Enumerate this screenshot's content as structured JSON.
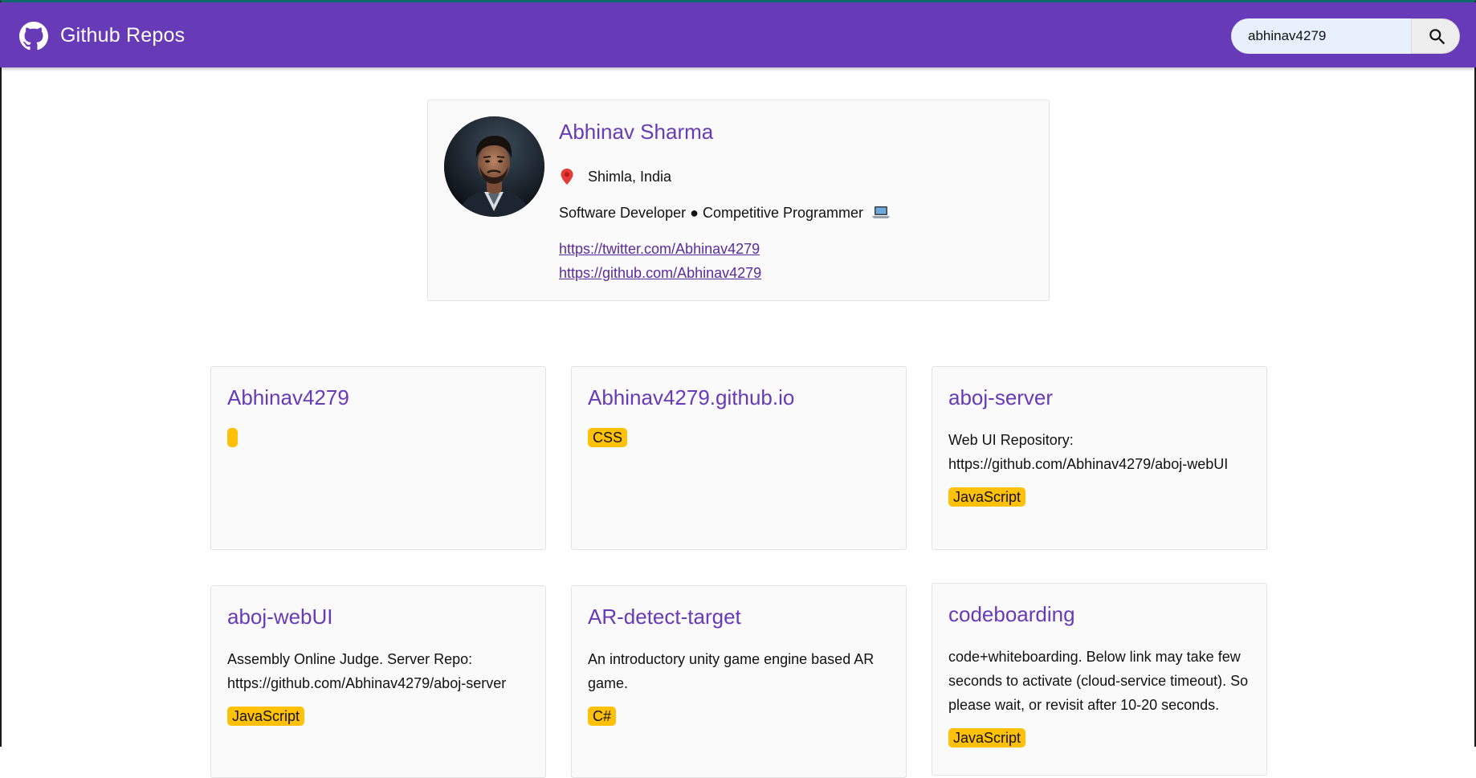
{
  "header": {
    "title": "Github Repos",
    "logo_icon": "github-icon",
    "brand_color": "#673ab7"
  },
  "search": {
    "value": "abhinav4279",
    "button_icon": "search-icon"
  },
  "profile": {
    "name": "Abhinav Sharma",
    "location_icon": "pin-icon",
    "location": "Shimla, India",
    "bio": "Software Developer ● Competitive Programmer",
    "bio_icon": "laptop-icon",
    "twitter_url": "https://twitter.com/Abhinav4279",
    "github_url": "https://github.com/Abhinav4279"
  },
  "repos": [
    {
      "name": "Abhinav4279",
      "description": "",
      "language": ""
    },
    {
      "name": "Abhinav4279.github.io",
      "description": "",
      "language": "CSS"
    },
    {
      "name": "aboj-server",
      "description": "Web UI Repository: https://github.com/Abhinav4279/aboj-webUI",
      "language": "JavaScript"
    },
    {
      "name": "aboj-webUI",
      "description": "Assembly Online Judge. Server Repo: https://github.com/Abhinav4279/aboj-server",
      "language": "JavaScript"
    },
    {
      "name": "AR-detect-target",
      "description": "An introductory unity game engine based AR game.",
      "language": "C#"
    },
    {
      "name": "codeboarding",
      "description": "code+whiteboarding. Below link may take few seconds to activate (cloud-service timeout). So please wait, or revisit after 10-20 seconds.",
      "language": "JavaScript"
    }
  ],
  "colors": {
    "accent": "#673ab7",
    "badge": "#ffc107",
    "card_bg": "#fafafa"
  }
}
